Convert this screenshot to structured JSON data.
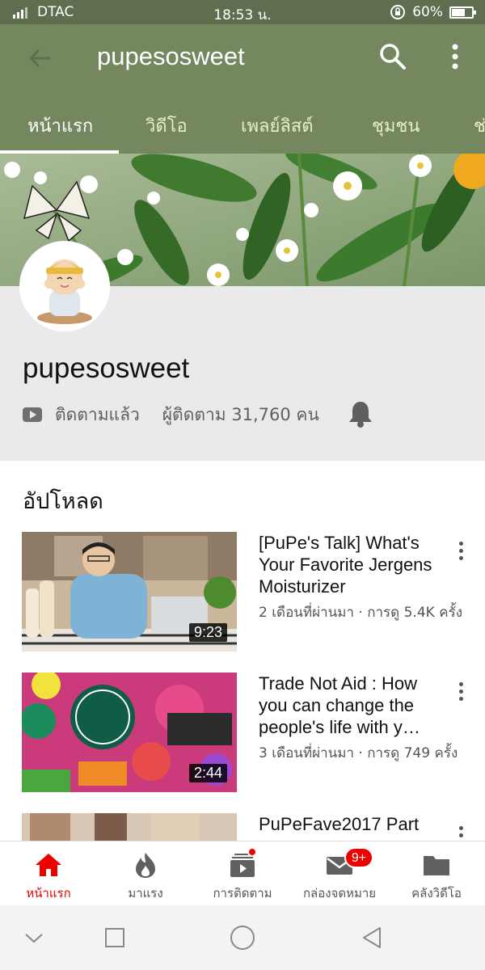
{
  "status_bar": {
    "carrier": "DTAC",
    "time": "18:53 น.",
    "battery": "60%"
  },
  "app_bar": {
    "title": "pupesosweet"
  },
  "tabs": [
    {
      "label": "หน้าแรก",
      "active": true
    },
    {
      "label": "วิดีโอ",
      "active": false
    },
    {
      "label": "เพลย์ลิสต์",
      "active": false
    },
    {
      "label": "ชุมชน",
      "active": false
    },
    {
      "label": "ช่",
      "active": false
    }
  ],
  "channel": {
    "name": "pupesosweet",
    "subscribe_status": "ติดตามแล้ว",
    "subscribers": "ผู้ติดตาม 31,760 คน"
  },
  "uploads": {
    "heading": "อัปโหลด",
    "videos": [
      {
        "title": "[PuPe's Talk] What's Your Favorite Jergens Moisturizer",
        "meta": "2 เดือนที่ผ่านมา · การดู 5.4K ครั้ง",
        "duration": "9:23"
      },
      {
        "title": "Trade Not Aid : How you can change the people's life with y…",
        "meta": "3 เดือนที่ผ่านมา · การดู 749 ครั้ง",
        "duration": "2:44"
      },
      {
        "title": "PuPeFave2017 Part",
        "meta": "",
        "duration": ""
      }
    ]
  },
  "bottom_nav": [
    {
      "label": "หน้าแรก",
      "icon": "home-icon",
      "active": true
    },
    {
      "label": "มาแรง",
      "icon": "trending-icon",
      "active": false
    },
    {
      "label": "การติดตาม",
      "icon": "subscriptions-icon",
      "active": false
    },
    {
      "label": "กล่องจดหมาย",
      "icon": "inbox-icon",
      "active": false
    },
    {
      "label": "คลังวิดีโอ",
      "icon": "library-icon",
      "active": false
    }
  ],
  "inbox_badge": "9+",
  "colors": {
    "app_bar": "#74875f",
    "status_bar": "#5e6e4e",
    "active_nav": "#e00000"
  }
}
